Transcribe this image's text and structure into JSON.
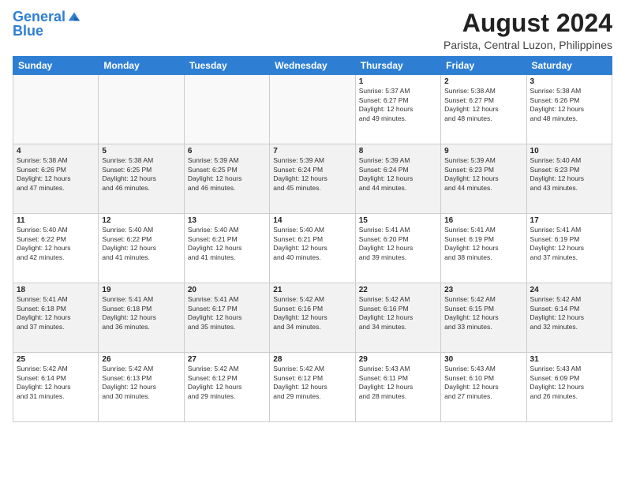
{
  "logo": {
    "line1": "General",
    "line2": "Blue"
  },
  "title": "August 2024",
  "subtitle": "Parista, Central Luzon, Philippines",
  "weekdays": [
    "Sunday",
    "Monday",
    "Tuesday",
    "Wednesday",
    "Thursday",
    "Friday",
    "Saturday"
  ],
  "weeks": [
    [
      {
        "day": "",
        "info": ""
      },
      {
        "day": "",
        "info": ""
      },
      {
        "day": "",
        "info": ""
      },
      {
        "day": "",
        "info": ""
      },
      {
        "day": "1",
        "info": "Sunrise: 5:37 AM\nSunset: 6:27 PM\nDaylight: 12 hours\nand 49 minutes."
      },
      {
        "day": "2",
        "info": "Sunrise: 5:38 AM\nSunset: 6:27 PM\nDaylight: 12 hours\nand 48 minutes."
      },
      {
        "day": "3",
        "info": "Sunrise: 5:38 AM\nSunset: 6:26 PM\nDaylight: 12 hours\nand 48 minutes."
      }
    ],
    [
      {
        "day": "4",
        "info": "Sunrise: 5:38 AM\nSunset: 6:26 PM\nDaylight: 12 hours\nand 47 minutes."
      },
      {
        "day": "5",
        "info": "Sunrise: 5:38 AM\nSunset: 6:25 PM\nDaylight: 12 hours\nand 46 minutes."
      },
      {
        "day": "6",
        "info": "Sunrise: 5:39 AM\nSunset: 6:25 PM\nDaylight: 12 hours\nand 46 minutes."
      },
      {
        "day": "7",
        "info": "Sunrise: 5:39 AM\nSunset: 6:24 PM\nDaylight: 12 hours\nand 45 minutes."
      },
      {
        "day": "8",
        "info": "Sunrise: 5:39 AM\nSunset: 6:24 PM\nDaylight: 12 hours\nand 44 minutes."
      },
      {
        "day": "9",
        "info": "Sunrise: 5:39 AM\nSunset: 6:23 PM\nDaylight: 12 hours\nand 44 minutes."
      },
      {
        "day": "10",
        "info": "Sunrise: 5:40 AM\nSunset: 6:23 PM\nDaylight: 12 hours\nand 43 minutes."
      }
    ],
    [
      {
        "day": "11",
        "info": "Sunrise: 5:40 AM\nSunset: 6:22 PM\nDaylight: 12 hours\nand 42 minutes."
      },
      {
        "day": "12",
        "info": "Sunrise: 5:40 AM\nSunset: 6:22 PM\nDaylight: 12 hours\nand 41 minutes."
      },
      {
        "day": "13",
        "info": "Sunrise: 5:40 AM\nSunset: 6:21 PM\nDaylight: 12 hours\nand 41 minutes."
      },
      {
        "day": "14",
        "info": "Sunrise: 5:40 AM\nSunset: 6:21 PM\nDaylight: 12 hours\nand 40 minutes."
      },
      {
        "day": "15",
        "info": "Sunrise: 5:41 AM\nSunset: 6:20 PM\nDaylight: 12 hours\nand 39 minutes."
      },
      {
        "day": "16",
        "info": "Sunrise: 5:41 AM\nSunset: 6:19 PM\nDaylight: 12 hours\nand 38 minutes."
      },
      {
        "day": "17",
        "info": "Sunrise: 5:41 AM\nSunset: 6:19 PM\nDaylight: 12 hours\nand 37 minutes."
      }
    ],
    [
      {
        "day": "18",
        "info": "Sunrise: 5:41 AM\nSunset: 6:18 PM\nDaylight: 12 hours\nand 37 minutes."
      },
      {
        "day": "19",
        "info": "Sunrise: 5:41 AM\nSunset: 6:18 PM\nDaylight: 12 hours\nand 36 minutes."
      },
      {
        "day": "20",
        "info": "Sunrise: 5:41 AM\nSunset: 6:17 PM\nDaylight: 12 hours\nand 35 minutes."
      },
      {
        "day": "21",
        "info": "Sunrise: 5:42 AM\nSunset: 6:16 PM\nDaylight: 12 hours\nand 34 minutes."
      },
      {
        "day": "22",
        "info": "Sunrise: 5:42 AM\nSunset: 6:16 PM\nDaylight: 12 hours\nand 34 minutes."
      },
      {
        "day": "23",
        "info": "Sunrise: 5:42 AM\nSunset: 6:15 PM\nDaylight: 12 hours\nand 33 minutes."
      },
      {
        "day": "24",
        "info": "Sunrise: 5:42 AM\nSunset: 6:14 PM\nDaylight: 12 hours\nand 32 minutes."
      }
    ],
    [
      {
        "day": "25",
        "info": "Sunrise: 5:42 AM\nSunset: 6:14 PM\nDaylight: 12 hours\nand 31 minutes."
      },
      {
        "day": "26",
        "info": "Sunrise: 5:42 AM\nSunset: 6:13 PM\nDaylight: 12 hours\nand 30 minutes."
      },
      {
        "day": "27",
        "info": "Sunrise: 5:42 AM\nSunset: 6:12 PM\nDaylight: 12 hours\nand 29 minutes."
      },
      {
        "day": "28",
        "info": "Sunrise: 5:42 AM\nSunset: 6:12 PM\nDaylight: 12 hours\nand 29 minutes."
      },
      {
        "day": "29",
        "info": "Sunrise: 5:43 AM\nSunset: 6:11 PM\nDaylight: 12 hours\nand 28 minutes."
      },
      {
        "day": "30",
        "info": "Sunrise: 5:43 AM\nSunset: 6:10 PM\nDaylight: 12 hours\nand 27 minutes."
      },
      {
        "day": "31",
        "info": "Sunrise: 5:43 AM\nSunset: 6:09 PM\nDaylight: 12 hours\nand 26 minutes."
      }
    ]
  ]
}
